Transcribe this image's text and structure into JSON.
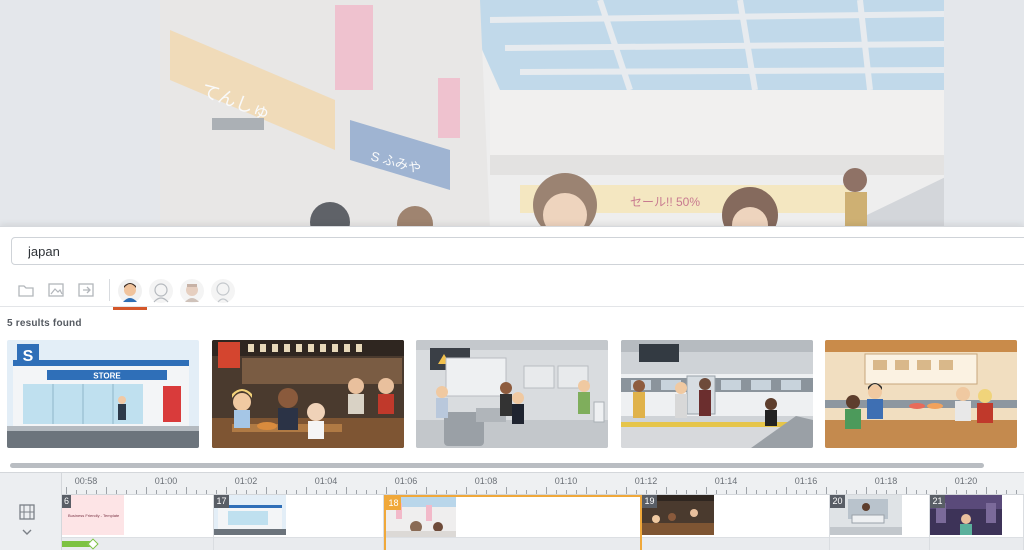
{
  "search": {
    "value": "japan",
    "placeholder": ""
  },
  "filters": {
    "icons": [
      "folder-icon",
      "image-folder-icon",
      "export-folder-icon"
    ],
    "avatars": [
      "character-avatar-1",
      "character-avatar-2",
      "character-avatar-3",
      "character-avatar-4"
    ],
    "active_avatar_index": 0
  },
  "results": {
    "count_text": "5 results found",
    "items": [
      {
        "name": "convenience-store",
        "sign_letter": "S",
        "store_label": "STORE"
      },
      {
        "name": "izakaya-bar"
      },
      {
        "name": "train-station-gates"
      },
      {
        "name": "train-platform"
      },
      {
        "name": "sushi-restaurant"
      }
    ]
  },
  "timeline": {
    "ruler": [
      "00:58",
      "01:00",
      "01:02",
      "01:04",
      "01:06",
      "01:08",
      "01:10",
      "01:12",
      "01:14",
      "01:16",
      "01:18",
      "01:20"
    ],
    "clips": [
      {
        "number": "6",
        "title": "Business Friendly - Template"
      },
      {
        "number": "17"
      },
      {
        "number": "18"
      },
      {
        "number": "19"
      },
      {
        "number": "20"
      },
      {
        "number": "21"
      }
    ],
    "selected_clip": "18"
  },
  "colors": {
    "accent": "#f0a83a",
    "active_underline": "#d4572a",
    "transition": "#7dc242",
    "panel_bg": "#ffffff"
  }
}
